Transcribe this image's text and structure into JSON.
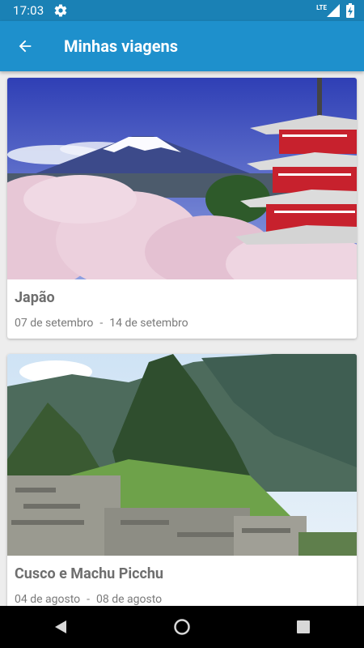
{
  "status_bar": {
    "time": "17:03",
    "network_label": "LTE",
    "icons": [
      "gear-icon",
      "signal-icon",
      "battery-charging-icon"
    ]
  },
  "app_bar": {
    "title": "Minhas viagens",
    "back_icon": "arrow-back-icon",
    "color": "#1e90cc"
  },
  "trips": [
    {
      "title": "Japão",
      "start_date": "07 de setembro",
      "separator": "-",
      "end_date": "14 de setembro",
      "image": "mount-fuji-pagoda-cherry-blossoms"
    },
    {
      "title": "Cusco e Machu Picchu",
      "start_date": "04 de agosto",
      "separator": "-",
      "end_date": "08 de agosto",
      "image": "machu-picchu-ruins"
    }
  ],
  "nav_bar": {
    "icons": [
      "back-triangle-icon",
      "home-circle-icon",
      "recents-square-icon"
    ]
  }
}
